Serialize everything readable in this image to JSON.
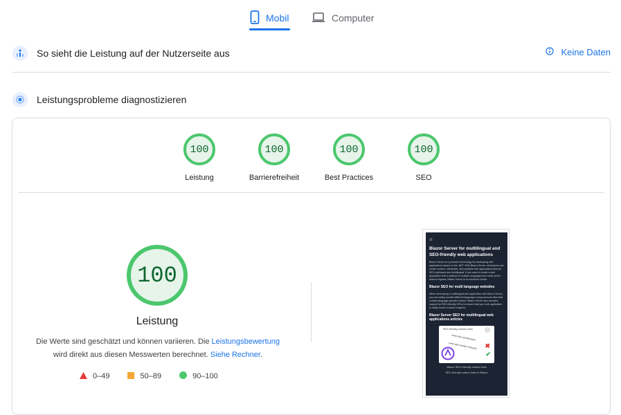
{
  "tabs": [
    {
      "label": "Mobil",
      "active": true,
      "icon": "smartphone-icon"
    },
    {
      "label": "Computer",
      "active": false,
      "icon": "laptop-icon"
    }
  ],
  "field_data": {
    "title": "So sieht die Leistung auf der Nutzerseite aus",
    "no_data_label": "Keine Daten",
    "icon": "field-data-icon"
  },
  "diagnose": {
    "title": "Leistungsprobleme diagnostizieren",
    "icon": "lab-data-icon"
  },
  "scores": [
    {
      "label": "Leistung",
      "value": "100"
    },
    {
      "label": "Barrierefreiheit",
      "value": "100"
    },
    {
      "label": "Best Practices",
      "value": "100"
    },
    {
      "label": "SEO",
      "value": "100"
    }
  ],
  "performance": {
    "score": "100",
    "label": "Leistung",
    "desc_part1": "Die Werte sind geschätzt und können variieren. Die ",
    "link1": "Leistungsbewertung",
    "desc_part2": " wird direkt aus diesen Messwerten berechnet. ",
    "link2": "Siehe Rechner",
    "desc_end": "."
  },
  "legend": [
    {
      "range": "0–49",
      "shape": "triangle",
      "color": "#e53935"
    },
    {
      "range": "50–89",
      "shape": "square",
      "color": "#f4a736"
    },
    {
      "range": "90–100",
      "shape": "circle",
      "color": "#4cc76d"
    }
  ],
  "colors": {
    "accent": "#1a73e8",
    "pass": "#4cc76d",
    "pass_text": "#0d652d"
  },
  "screenshot": {
    "heading": "Blazor Server for multilingual and SEO-friendly web applications",
    "intro": "Blazor Server is a powerful technology for developing web applications based on the .NET. With Blazor Server, developers can create modern, interactive, and scalable web applications that are SEO-optimized and multilingual. If you want to create a web application that is tailored to multiple languages and ranks well in search engines, Blazor Server is an excellent choice.",
    "section1": "Blazor SEO for multi language websites",
    "section1_text": "When developing a multilingual web application with Blazor Server, you can easily provide different languages using resource files that contain language-specific content. Blazor Server also provides support for SEO-friendly URLs to ensure that your web application is easily found in search engines.",
    "section2": "Blazor Server SEO for multilingual web applications articles",
    "thumb_title": "SEO-friendly-Culture-Links",
    "thumb_url1": "www.cplx.com/de/sushi",
    "thumb_url2": "www.cplx.com/de-CH/sushi",
    "caption1": "Blazor SEO-friendly culture links",
    "caption2": "SEO friendly culture links in Blazor"
  }
}
